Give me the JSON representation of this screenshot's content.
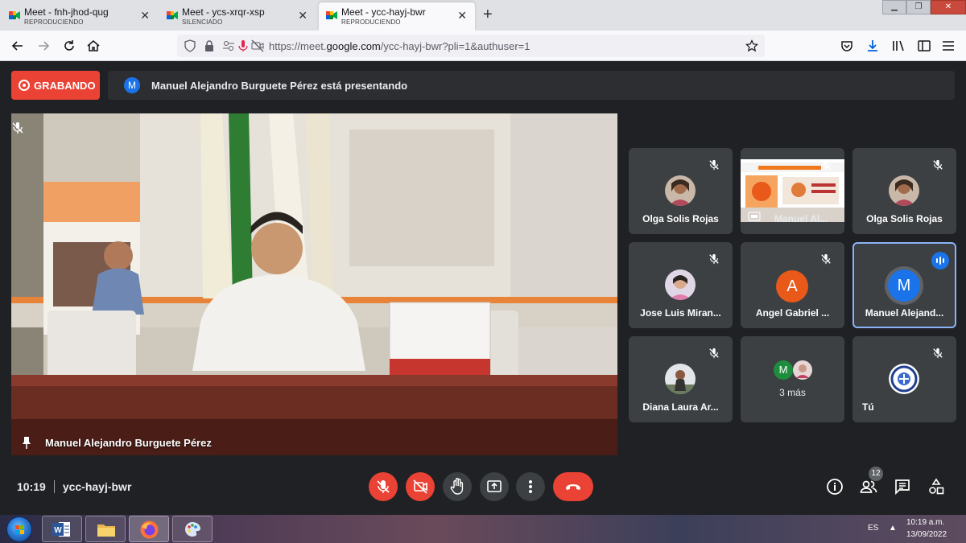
{
  "browser": {
    "tabs": [
      {
        "title": "Meet - fnh-jhod-qug",
        "status": "REPRODUCIENDO"
      },
      {
        "title": "Meet - ycs-xrqr-xsp",
        "status": "SILENCIADO"
      },
      {
        "title": "Meet - ycc-hayj-bwr",
        "status": "REPRODUCIENDO"
      }
    ],
    "url_prefix": "https://meet.",
    "url_domain": "google.com",
    "url_path": "/ycc-hayj-bwr?pli=1&authuser=1"
  },
  "meet": {
    "recording_label": "GRABANDO",
    "presenter_initial": "M",
    "presenting_text": "Manuel Alejandro Burguete Pérez está presentando",
    "main_speaker": "Manuel Alejandro Burguete Pérez",
    "participants": [
      {
        "name": "Olga Solis Rojas"
      },
      {
        "name": "Manuel Al..."
      },
      {
        "name": "Olga Solis Rojas"
      },
      {
        "name": "Jose Luis Miran..."
      },
      {
        "name": "Angel Gabriel ...",
        "initial": "A"
      },
      {
        "name": "Manuel Alejand...",
        "initial": "M"
      },
      {
        "name": "Diana Laura Ar..."
      },
      {
        "name": "3 más",
        "initial": "M"
      },
      {
        "name": "Tú"
      }
    ],
    "time": "10:19",
    "meeting_code": "ycc-hayj-bwr",
    "participant_count": "12",
    "colors": {
      "accent": "#1a73e8",
      "danger": "#ea4335",
      "bg": "#202124",
      "tile": "#3c4043",
      "avatar_a": "#e8591a"
    }
  },
  "taskbar": {
    "language": "ES",
    "clock_time": "10:19 a.m.",
    "clock_date": "13/09/2022"
  }
}
